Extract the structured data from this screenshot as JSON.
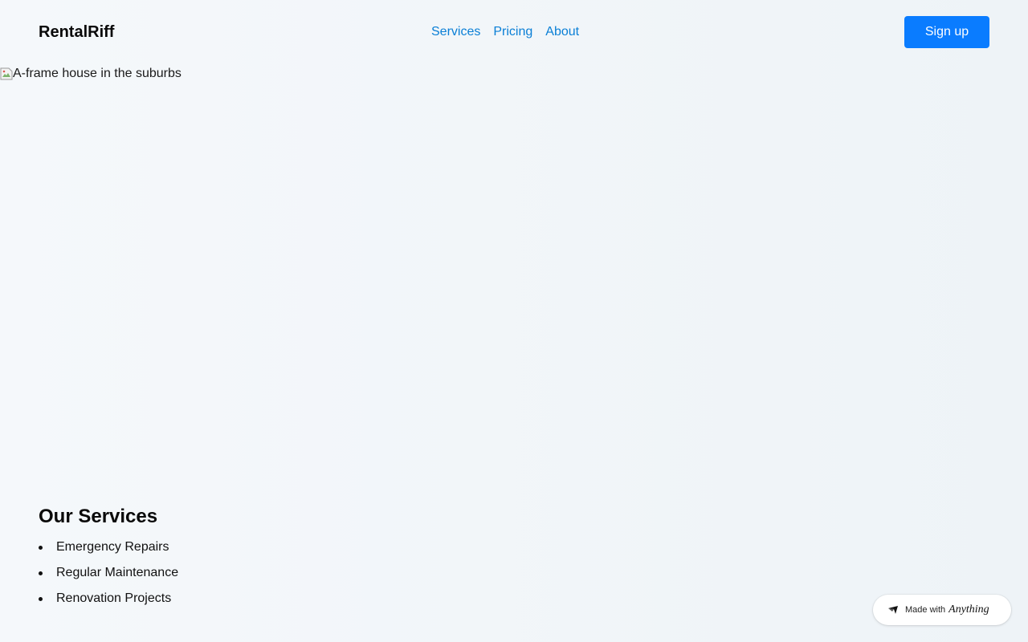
{
  "header": {
    "brand": "RentalRiff",
    "nav": [
      {
        "label": "Services"
      },
      {
        "label": "Pricing"
      },
      {
        "label": "About"
      }
    ],
    "signup_label": "Sign up"
  },
  "hero": {
    "image_alt": "A-frame house in the suburbs"
  },
  "services": {
    "title": "Our Services",
    "items": [
      {
        "label": "Emergency Repairs"
      },
      {
        "label": "Regular Maintenance"
      },
      {
        "label": "Renovation Projects"
      }
    ]
  },
  "badge": {
    "prefix": "Made with",
    "brand": "Anything"
  },
  "colors": {
    "accent": "#0a7cff",
    "link": "#0a7fd6"
  }
}
